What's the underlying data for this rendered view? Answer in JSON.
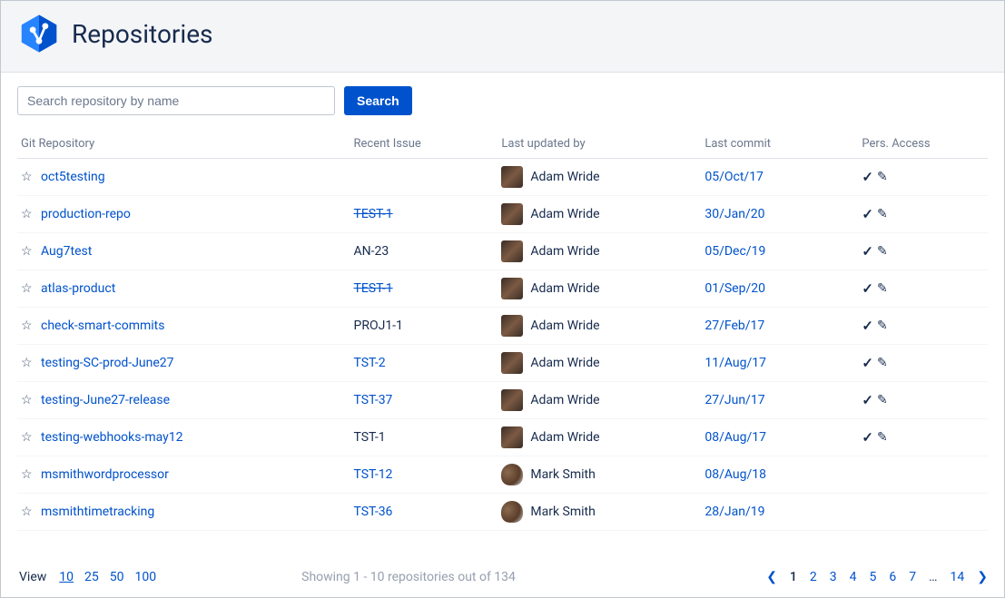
{
  "header": {
    "title": "Repositories"
  },
  "search": {
    "placeholder": "Search repository by name",
    "button_label": "Search"
  },
  "columns": {
    "repo": "Git Repository",
    "issue": "Recent Issue",
    "updated": "Last updated by",
    "commit": "Last commit",
    "access": "Pers. Access"
  },
  "rows": [
    {
      "repo": "oct5testing",
      "issue": "",
      "issue_link": false,
      "issue_strike": false,
      "user": "Adam Wride",
      "avatar": "adam",
      "commit": "05/Oct/17",
      "access": true
    },
    {
      "repo": "production-repo",
      "issue": "TEST-1",
      "issue_link": true,
      "issue_strike": true,
      "user": "Adam Wride",
      "avatar": "adam",
      "commit": "30/Jan/20",
      "access": true
    },
    {
      "repo": "Aug7test",
      "issue": "AN-23",
      "issue_link": false,
      "issue_strike": false,
      "user": "Adam Wride",
      "avatar": "adam",
      "commit": "05/Dec/19",
      "access": true
    },
    {
      "repo": "atlas-product",
      "issue": "TEST-1",
      "issue_link": true,
      "issue_strike": true,
      "user": "Adam Wride",
      "avatar": "adam",
      "commit": "01/Sep/20",
      "access": true
    },
    {
      "repo": "check-smart-commits",
      "issue": "PROJ1-1",
      "issue_link": false,
      "issue_strike": false,
      "user": "Adam Wride",
      "avatar": "adam",
      "commit": "27/Feb/17",
      "access": true
    },
    {
      "repo": "testing-SC-prod-June27",
      "issue": "TST-2",
      "issue_link": true,
      "issue_strike": false,
      "user": "Adam Wride",
      "avatar": "adam",
      "commit": "11/Aug/17",
      "access": true
    },
    {
      "repo": "testing-June27-release",
      "issue": "TST-37",
      "issue_link": true,
      "issue_strike": false,
      "user": "Adam Wride",
      "avatar": "adam",
      "commit": "27/Jun/17",
      "access": true
    },
    {
      "repo": "testing-webhooks-may12",
      "issue": "TST-1",
      "issue_link": false,
      "issue_strike": false,
      "user": "Adam Wride",
      "avatar": "adam",
      "commit": "08/Aug/17",
      "access": true
    },
    {
      "repo": "msmithwordprocessor",
      "issue": "TST-12",
      "issue_link": true,
      "issue_strike": false,
      "user": "Mark Smith",
      "avatar": "mark",
      "commit": "08/Aug/18",
      "access": false
    },
    {
      "repo": "msmithtimetracking",
      "issue": "TST-36",
      "issue_link": true,
      "issue_strike": false,
      "user": "Mark Smith",
      "avatar": "mark",
      "commit": "28/Jan/19",
      "access": false
    }
  ],
  "footer": {
    "view_label": "View",
    "page_sizes": [
      "10",
      "25",
      "50",
      "100"
    ],
    "active_page_size": "10",
    "showing": "Showing 1 - 10 repositories out of 134",
    "pages": [
      "1",
      "2",
      "3",
      "4",
      "5",
      "6",
      "7",
      "…",
      "14"
    ],
    "current_page": "1"
  }
}
